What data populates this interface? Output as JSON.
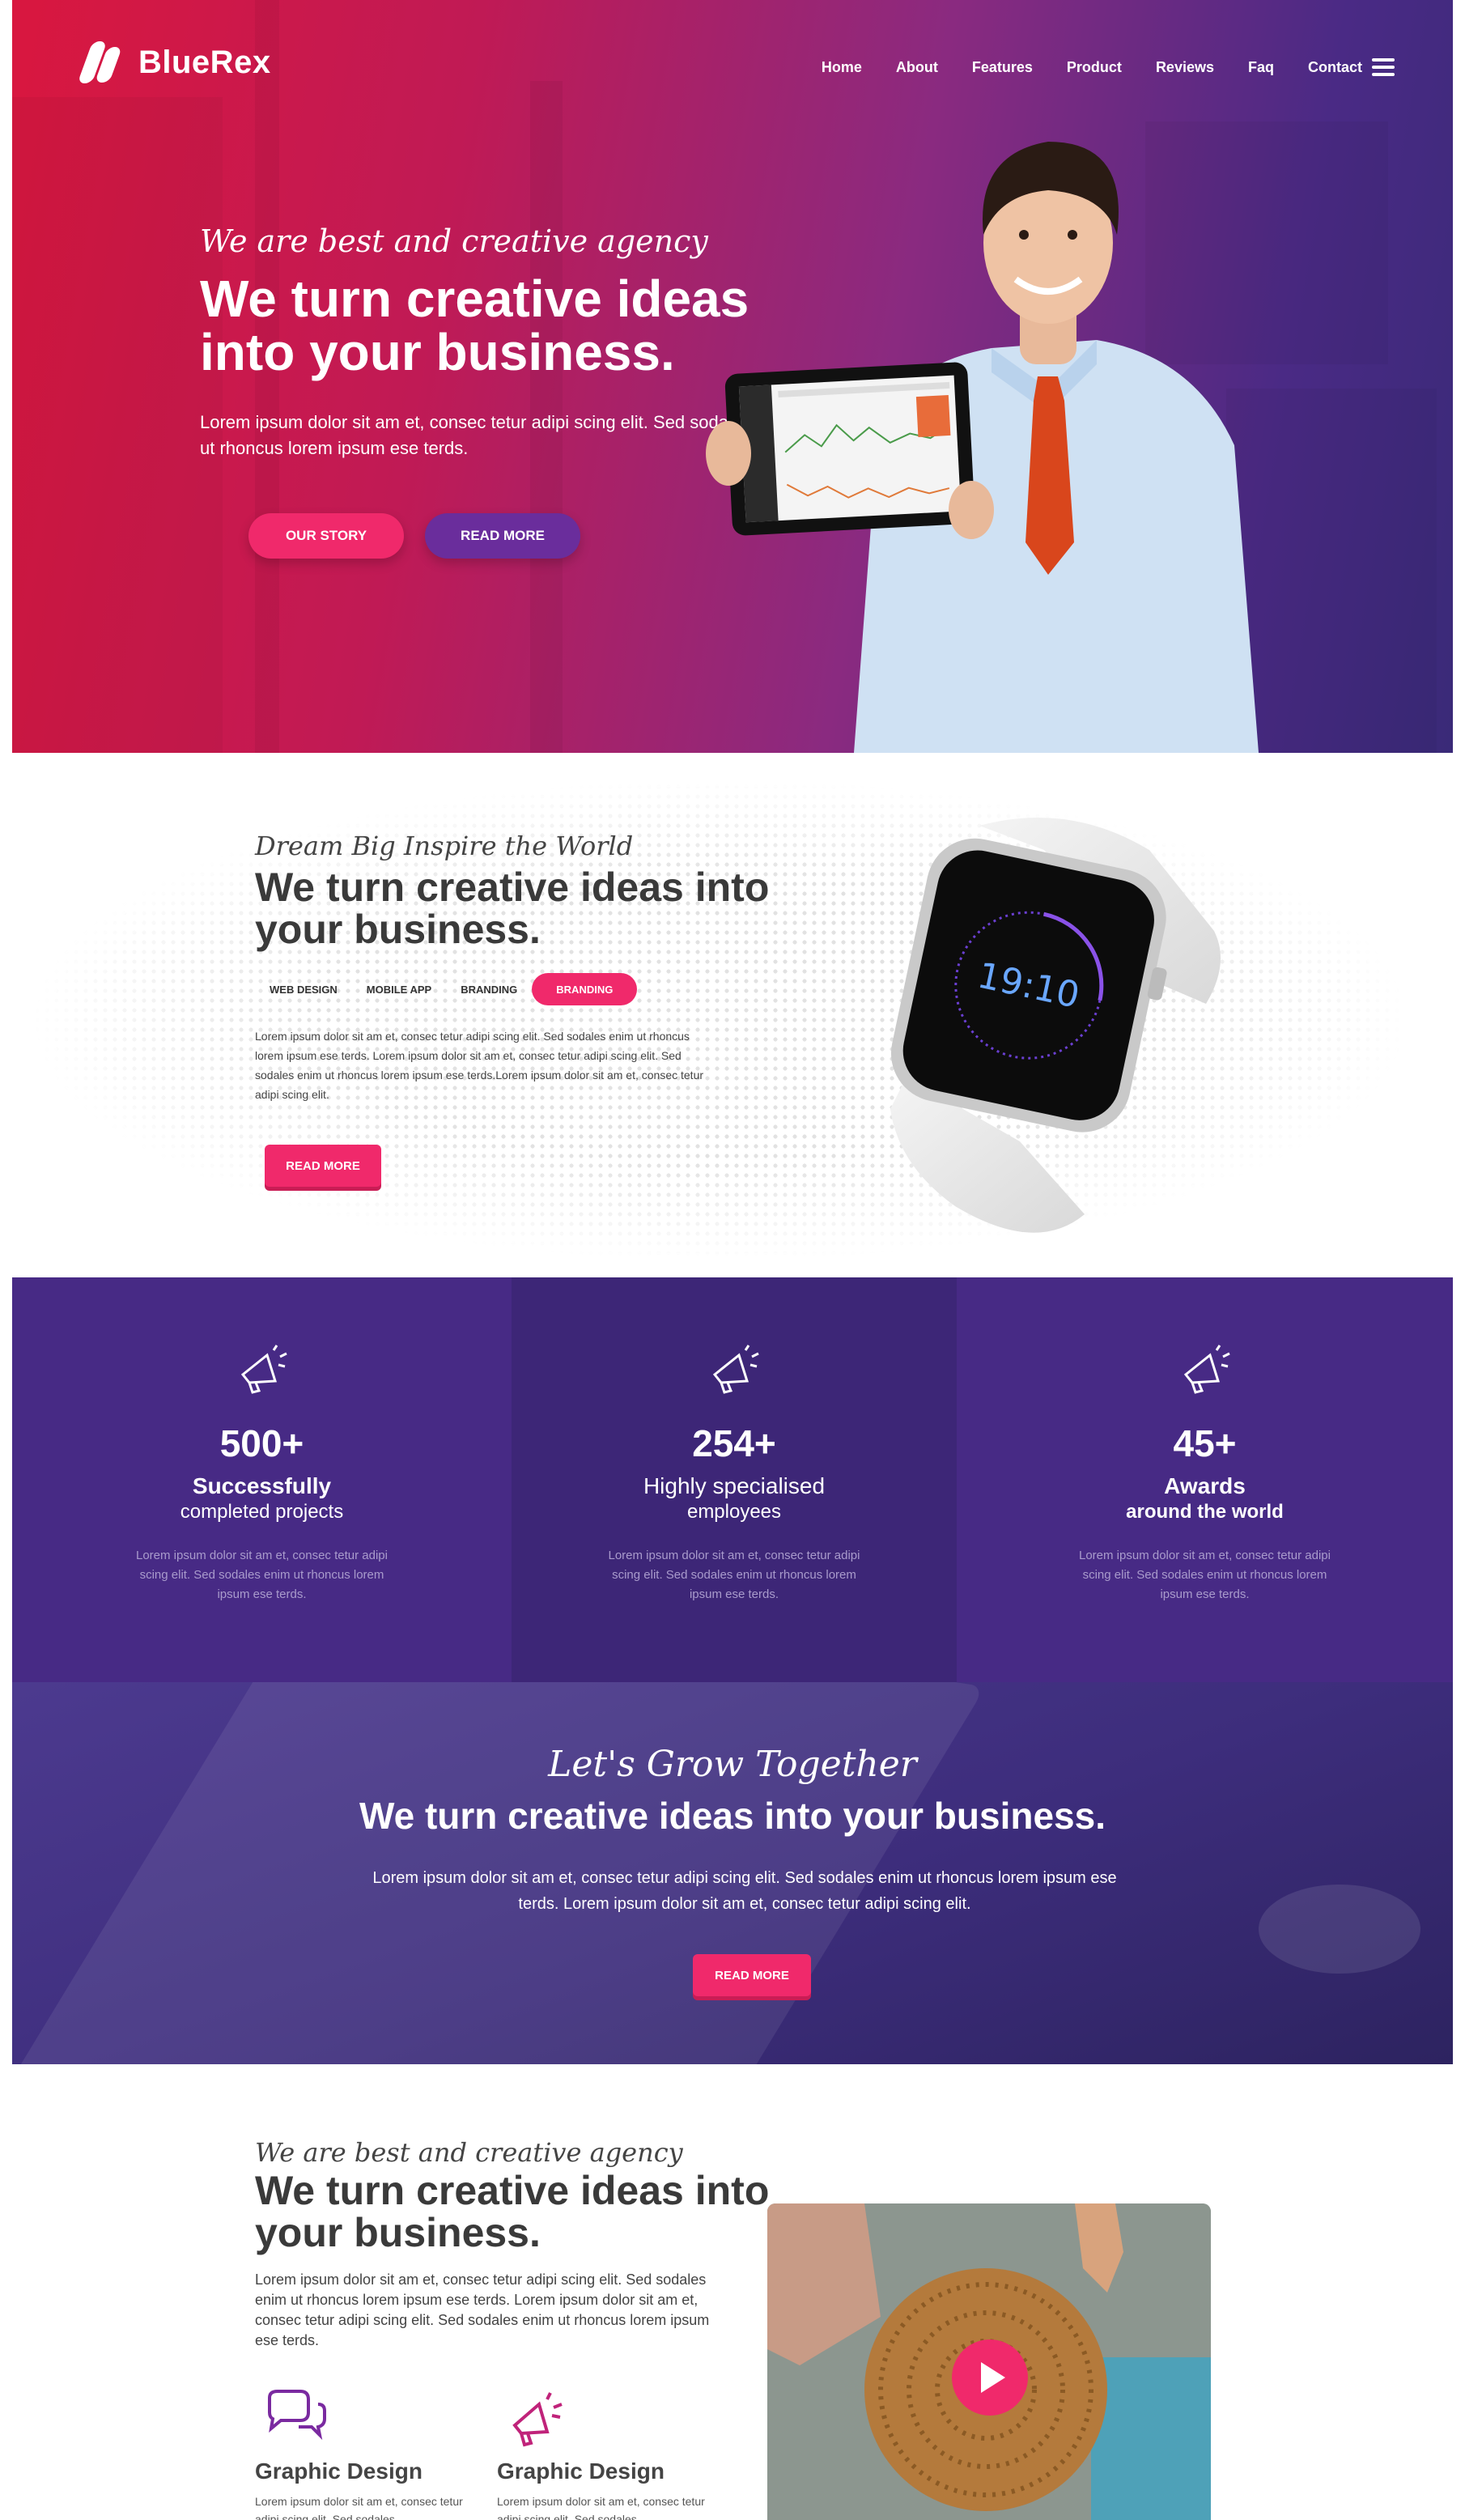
{
  "header": {
    "brand": "BlueRex",
    "nav": [
      "Home",
      "About",
      "Features",
      "Product",
      "Reviews",
      "Faq",
      "Contact"
    ]
  },
  "hero": {
    "subtitle": "We are best and creative agency",
    "title": "We turn creative ideas into your business.",
    "description": "Lorem ipsum dolor sit am et, consec tetur adipi scing elit. Sed sodales enim ut rhoncus lorem ipsum ese terds.",
    "btn_primary": "OUR STORY",
    "btn_secondary": "READ MORE"
  },
  "intro": {
    "subtitle": "Dream Big Inspire the World",
    "title": "We turn creative ideas into your business.",
    "tabs": [
      "WEB DESIGN",
      "MOBILE APP",
      "BRANDING",
      "BRANDING"
    ],
    "description": "Lorem ipsum dolor sit am et, consec tetur adipi scing elit. Sed sodales enim ut rhoncus lorem ipsum ese terds. Lorem ipsum dolor sit am et, consec tetur adipi scing elit. Sed sodales enim ut rhoncus lorem ipsum ese terds.Lorem ipsum dolor sit am et, consec tetur adipi scing elit.",
    "button": "READ MORE",
    "watch_time": "19:10"
  },
  "stats": [
    {
      "number": "500+",
      "line1": "Successfully",
      "line2": "completed projects",
      "text": "Lorem ipsum dolor sit am et, consec tetur adipi scing elit. Sed sodales enim ut rhoncus lorem ipsum ese terds."
    },
    {
      "number": "254+",
      "line1": "Highly specialised",
      "line2": "employees",
      "text": "Lorem ipsum dolor sit am et, consec tetur adipi scing elit. Sed sodales enim ut rhoncus lorem ipsum ese terds."
    },
    {
      "number": "45+",
      "line1": "Awards",
      "line2": "around the world",
      "text": "Lorem ipsum dolor sit am et, consec tetur adipi scing elit. Sed sodales enim ut rhoncus lorem ipsum ese terds."
    }
  ],
  "grow": {
    "subtitle": "Let's Grow Together",
    "title": "We turn creative ideas into your business.",
    "description": "Lorem ipsum dolor sit am et, consec tetur adipi scing elit. Sed sodales enim ut rhoncus lorem ipsum ese terds. Lorem ipsum dolor sit am et, consec tetur adipi scing elit.",
    "button": "READ MORE"
  },
  "about": {
    "subtitle": "We are best and creative agency",
    "title": "We turn creative ideas into your business.",
    "description": "Lorem ipsum dolor sit am et, consec tetur adipi scing elit. Sed sodales enim ut rhoncus lorem ipsum ese terds. Lorem ipsum dolor sit am et, consec tetur adipi scing elit. Sed sodales enim ut rhoncus lorem ipsum ese terds.",
    "services": [
      {
        "title": "Graphic Design",
        "text": "Lorem ipsum dolor sit am et, consec tetur adipi scing elit. Sed sodales"
      },
      {
        "title": "Graphic Design",
        "text": "Lorem ipsum dolor sit am et, consec tetur adipi scing elit. Sed sodales"
      }
    ]
  },
  "colors": {
    "accent": "#f0296b",
    "purple": "#472a85",
    "dark_purple": "#3d2677"
  }
}
